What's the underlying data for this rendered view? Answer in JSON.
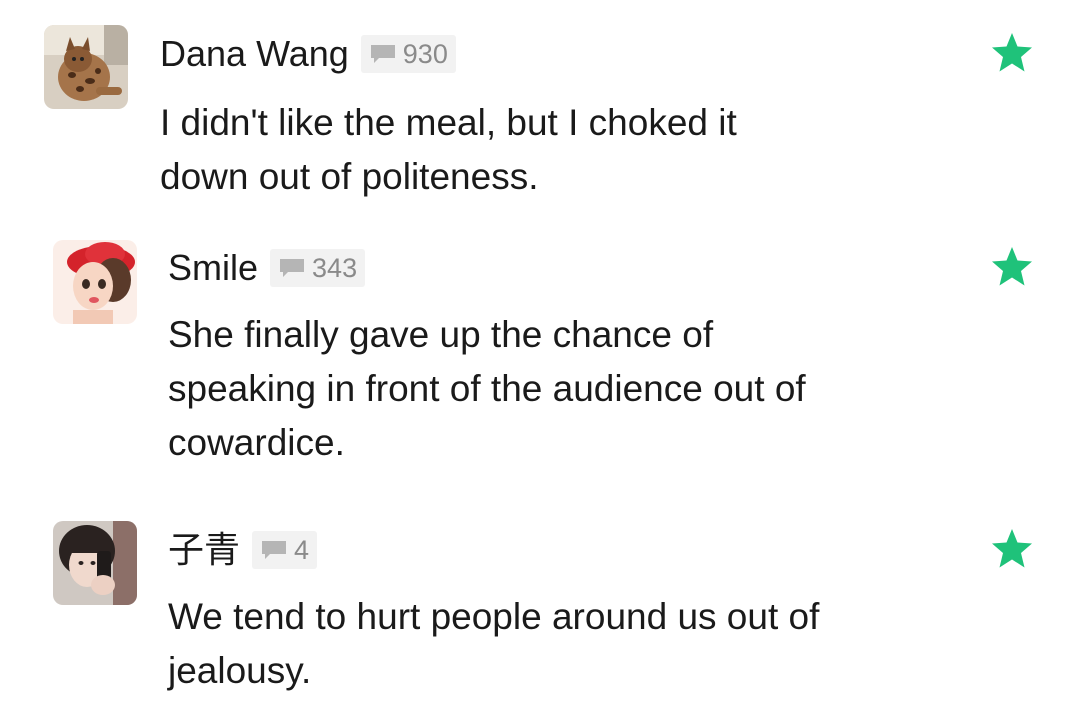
{
  "comments": [
    {
      "username": "Dana Wang",
      "count": "930",
      "text_lines": [
        "I didn't like the meal, but I choked it",
        "down out of politeness."
      ],
      "avatar_icon": "cat-avatar",
      "starred": true
    },
    {
      "username": "Smile",
      "count": "343",
      "text_lines": [
        "She finally gave up the chance of",
        "speaking in front of the audience out of",
        "cowardice."
      ],
      "avatar_icon": "cartoon-girl-avatar",
      "starred": true
    },
    {
      "username": "子青",
      "count": "4",
      "text_lines": [
        "We tend to hurt people around us out of",
        "jealousy."
      ],
      "avatar_icon": "selfie-photo-avatar",
      "starred": true
    }
  ],
  "colors": {
    "star": "#1fc27a",
    "badge_bg": "#f2f2f2",
    "badge_text": "#8a8a8a",
    "text": "#1a1a1a"
  }
}
